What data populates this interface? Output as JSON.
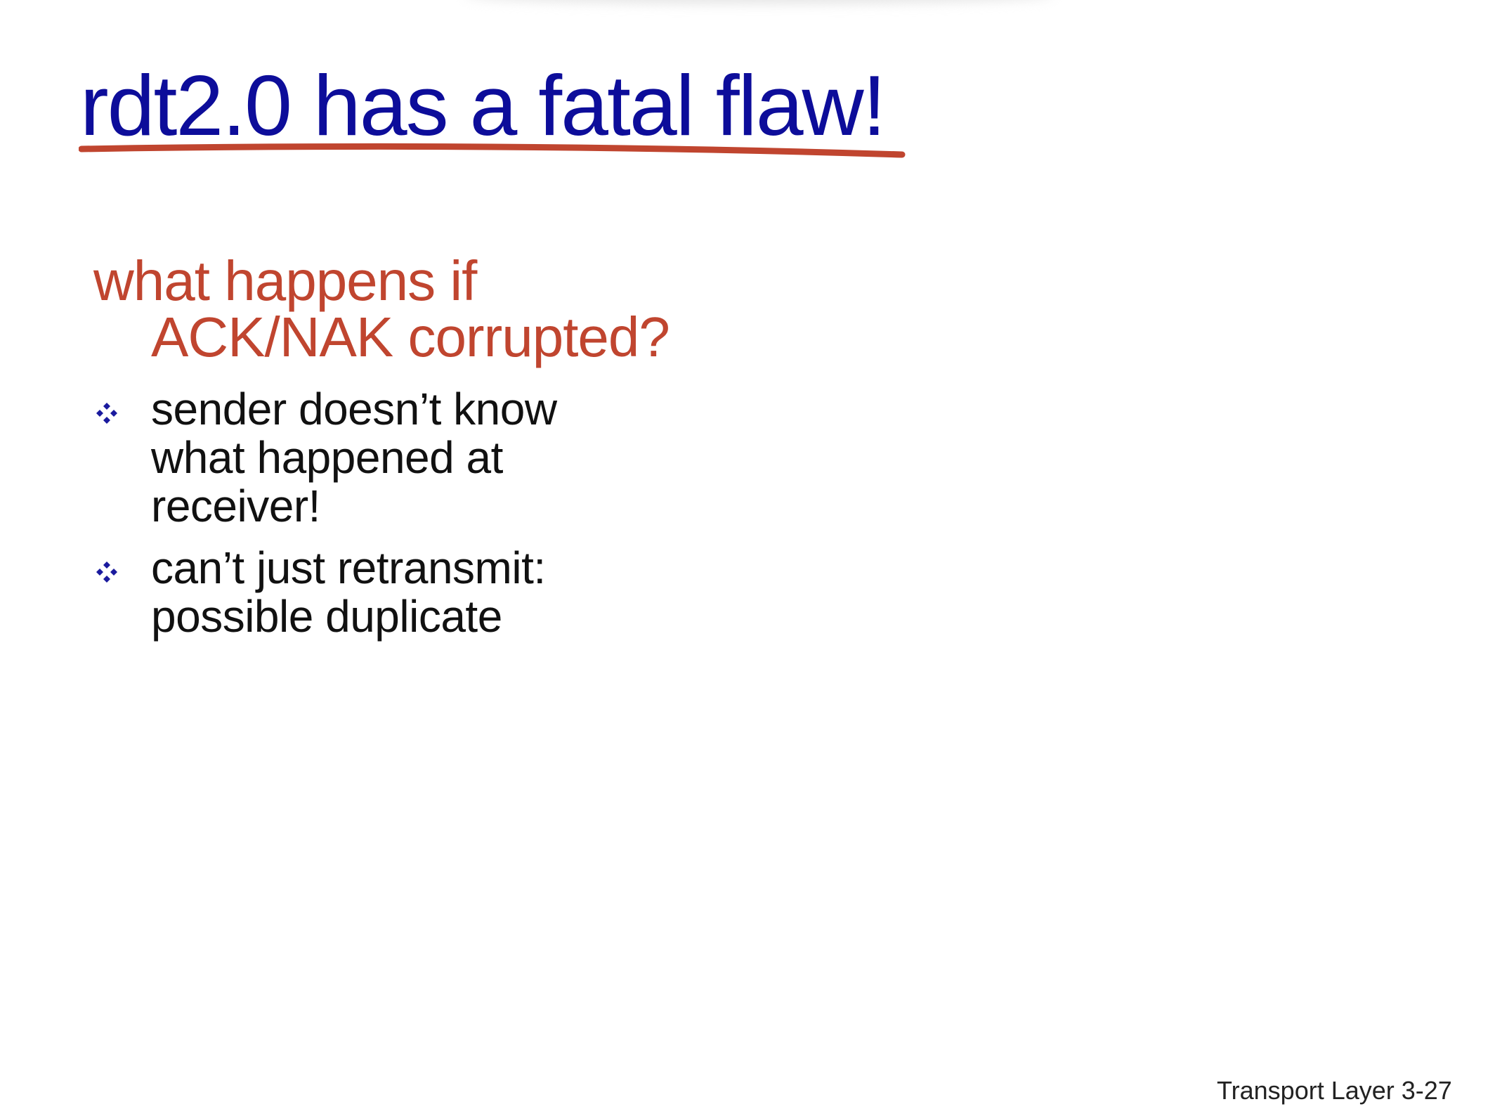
{
  "slide": {
    "title": "rdt2.0 has a fatal flaw!",
    "question_line1": "what happens if",
    "question_line2": "ACK/NAK corrupted?",
    "bullets": [
      {
        "lines": [
          "sender doesn’t know",
          "what happened at",
          "receiver!"
        ]
      },
      {
        "lines": [
          "can’t just retransmit:",
          "possible duplicate"
        ]
      }
    ],
    "footer": "Transport Layer 3-27"
  },
  "colors": {
    "title": "#0d0d9a",
    "accent": "#c0452f",
    "text": "#111111",
    "bullet": "#1a1a9e"
  },
  "icons": {
    "bullet": "four-diamond-bullet-icon"
  }
}
